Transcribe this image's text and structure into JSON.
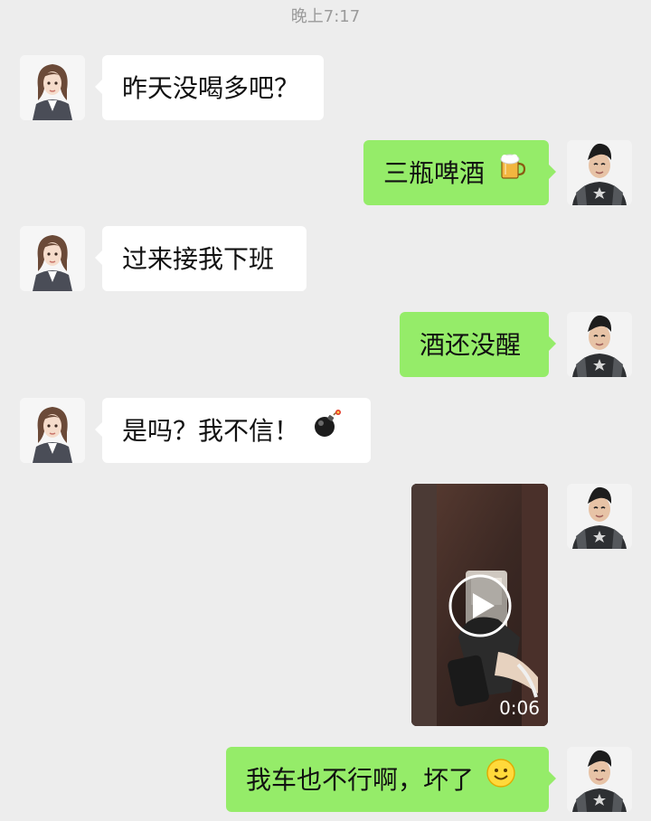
{
  "timestamp": "晚上7:17",
  "messages": [
    {
      "from": "contact",
      "text": "昨天没喝多吧？"
    },
    {
      "from": "me",
      "text": "三瓶啤酒",
      "emoji": "beer-mug-emoji"
    },
    {
      "from": "contact",
      "text": "过来接我下班"
    },
    {
      "from": "me",
      "text": "酒还没醒"
    },
    {
      "from": "contact",
      "text": "是吗？我不信！",
      "emoji": "bomb-emoji"
    },
    {
      "from": "me",
      "type": "video",
      "duration": "0:06"
    },
    {
      "from": "me",
      "text": "我车也不行啊，坏了",
      "emoji": "smile-emoji"
    }
  ],
  "colors": {
    "background": "#ededed",
    "incoming_bubble": "#ffffff",
    "outgoing_bubble": "#95ec69",
    "timestamp_text": "#9b9b9b"
  }
}
